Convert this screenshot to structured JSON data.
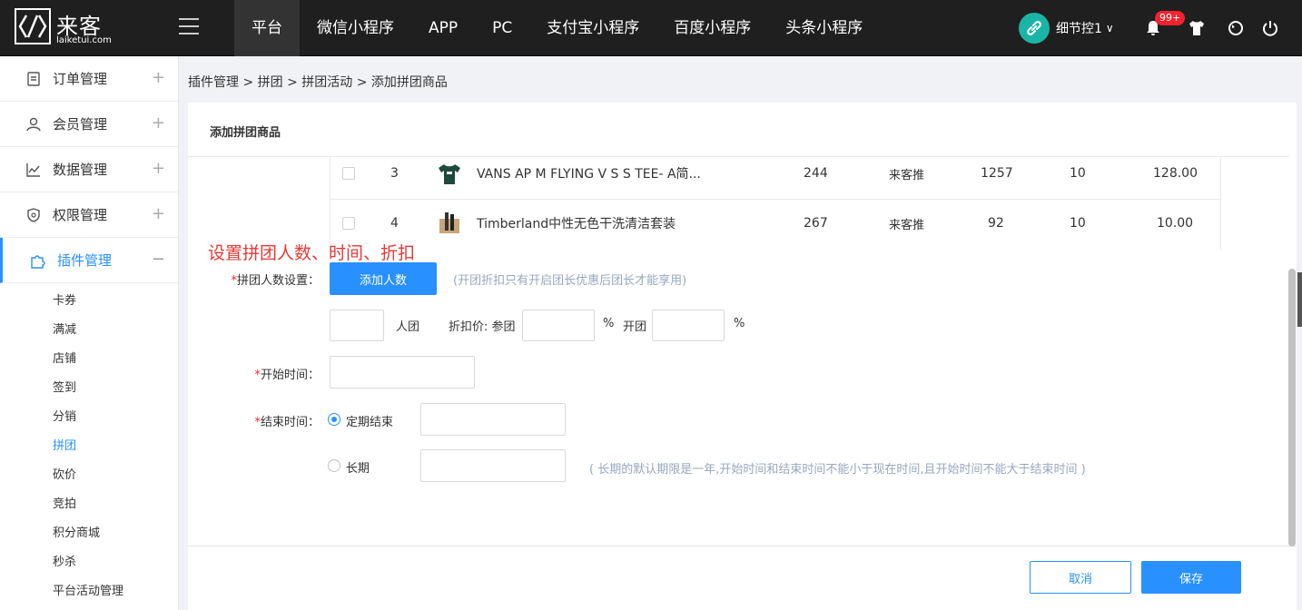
{
  "logo": {
    "cn": "来客",
    "en": "laiketui.com"
  },
  "nav": [
    "平台",
    "微信小程序",
    "APP",
    "PC",
    "支付宝小程序",
    "百度小程序",
    "头条小程序"
  ],
  "user": {
    "name": "细节控1",
    "caret": "∨",
    "badge": "99+"
  },
  "icons": [
    "link-icon",
    "bell-icon",
    "tshirt-icon",
    "refresh-icon",
    "power-icon"
  ],
  "sidebar": {
    "items": [
      {
        "label": "订单管理",
        "toggle": "+",
        "icon": "clipboard-icon"
      },
      {
        "label": "会员管理",
        "toggle": "+",
        "icon": "user-icon"
      },
      {
        "label": "数据管理",
        "toggle": "+",
        "icon": "chart-icon"
      },
      {
        "label": "权限管理",
        "toggle": "+",
        "icon": "shield-icon"
      },
      {
        "label": "插件管理",
        "toggle": "−",
        "icon": "puzzle-icon"
      }
    ],
    "sub_items": [
      "卡券",
      "满减",
      "店铺",
      "签到",
      "分销",
      "拼团",
      "砍价",
      "竞拍",
      "积分商城",
      "秒杀",
      "平台活动管理"
    ],
    "active_sub": "拼团"
  },
  "breadcrumb": "插件管理 > 拼团 > 拼团活动 > 添加拼团商品",
  "card_title": "添加拼团商品",
  "table_rows": [
    {
      "index": "3",
      "name": "VANS AP M FLYING V S S TEE- A简...",
      "stock": "244",
      "store": "来客推",
      "sales": "1257",
      "qty": "10",
      "price": "128.00"
    },
    {
      "index": "4",
      "name": "Timberland中性无色干洗清洁套装",
      "stock": "267",
      "store": "来客推",
      "sales": "92",
      "qty": "10",
      "price": "10.00"
    }
  ],
  "annotation": "设置拼团人数、时间、折扣",
  "form": {
    "group_label": "拼团人数设置：",
    "add_button": "添加人数",
    "group_hint": "(开团折扣只有开启团长优惠后团长才能享用)",
    "people_unit": "人团",
    "discount_label": "折扣价: 参团",
    "percent": "%",
    "open_label": "开团",
    "start_label": "开始时间：",
    "end_label": "结束时间：",
    "radio_fixed": "定期结束",
    "radio_long": "长期",
    "long_hint": "( 长期的默认期限是一年,开始时间和结束时间不能小于现在时间,且开始时间不能大于结束时间 )",
    "required_mark": "*"
  },
  "footer": {
    "cancel": "取消",
    "save": "保存"
  },
  "colors": {
    "primary": "#2890ff",
    "annotation": "#e53935",
    "topbar": "#1f1f1f"
  }
}
